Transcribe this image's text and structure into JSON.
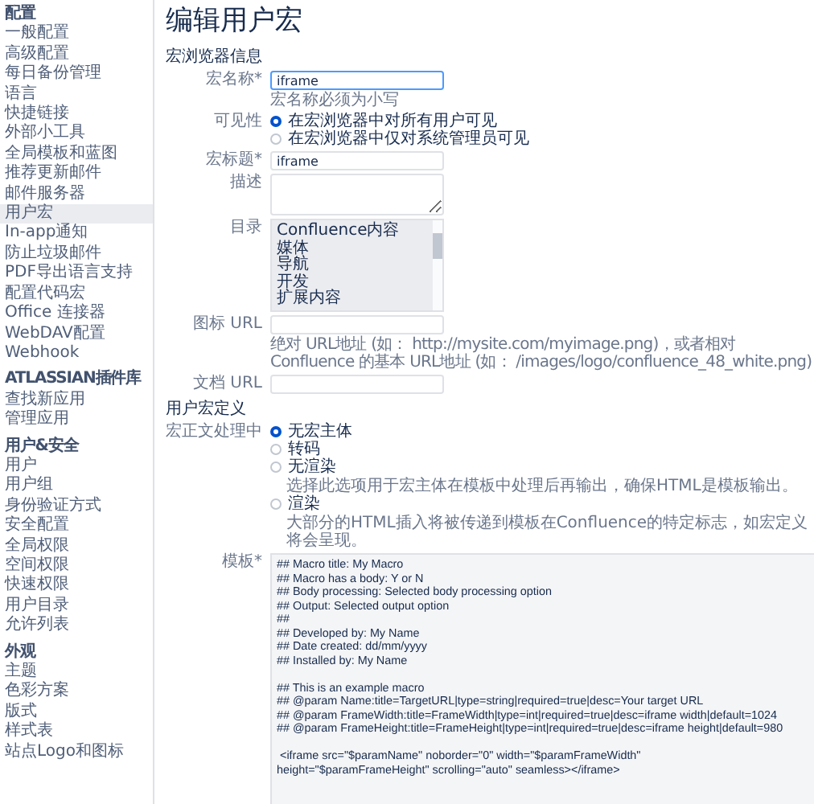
{
  "sidebar": {
    "sections": [
      {
        "heading": "配置",
        "items": [
          {
            "label": "一般配置",
            "selected": false
          },
          {
            "label": "高级配置",
            "selected": false
          },
          {
            "label": "每日备份管理",
            "selected": false
          },
          {
            "label": "语言",
            "selected": false
          },
          {
            "label": "快捷链接",
            "selected": false
          },
          {
            "label": "外部小工具",
            "selected": false
          },
          {
            "label": "全局模板和蓝图",
            "selected": false
          },
          {
            "label": "推荐更新邮件",
            "selected": false
          },
          {
            "label": "邮件服务器",
            "selected": false
          },
          {
            "label": "用户宏",
            "selected": true
          },
          {
            "label": "In-app通知",
            "selected": false
          },
          {
            "label": "防止垃圾邮件",
            "selected": false
          },
          {
            "label": "PDF导出语言支持",
            "selected": false
          },
          {
            "label": "配置代码宏",
            "selected": false
          },
          {
            "label": "Office 连接器",
            "selected": false
          },
          {
            "label": "WebDAV配置",
            "selected": false
          },
          {
            "label": "Webhook",
            "selected": false
          }
        ]
      },
      {
        "heading": "ATLASSIAN插件库",
        "items": [
          {
            "label": "查找新应用",
            "selected": false
          },
          {
            "label": "管理应用",
            "selected": false
          }
        ]
      },
      {
        "heading": "用户&安全",
        "items": [
          {
            "label": "用户",
            "selected": false
          },
          {
            "label": "用户组",
            "selected": false
          },
          {
            "label": "身份验证方式",
            "selected": false
          },
          {
            "label": "安全配置",
            "selected": false
          },
          {
            "label": "全局权限",
            "selected": false
          },
          {
            "label": "空间权限",
            "selected": false
          },
          {
            "label": "快速权限",
            "selected": false
          },
          {
            "label": "用户目录",
            "selected": false
          },
          {
            "label": "允许列表",
            "selected": false
          }
        ]
      },
      {
        "heading": "外观",
        "items": [
          {
            "label": "主题",
            "selected": false
          },
          {
            "label": "色彩方案",
            "selected": false
          },
          {
            "label": "版式",
            "selected": false
          },
          {
            "label": "样式表",
            "selected": false
          },
          {
            "label": "站点Logo和图标",
            "selected": false
          }
        ]
      }
    ]
  },
  "title": "编辑用户宏",
  "browser_section": {
    "heading": "宏浏览器信息",
    "name": {
      "label": "宏名称*",
      "value": "iframe",
      "help": "宏名称必须为小写"
    },
    "visibility": {
      "label": "可见性",
      "options": [
        {
          "label": "在宏浏览器中对所有用户可见",
          "selected": true
        },
        {
          "label": "在宏浏览器中仅对系统管理员可见",
          "selected": false
        }
      ]
    },
    "macro_title": {
      "label": "宏标题*",
      "value": "iframe"
    },
    "description": {
      "label": "描述"
    },
    "categories": {
      "label": "目录",
      "items": [
        "Confluence内容",
        "媒体",
        "导航",
        "开发",
        "扩展内容"
      ]
    },
    "icon_url": {
      "label": "图标 URL",
      "help": "绝对 URL地址 (如： http://mysite.com/myimage.png)，或者相对 Confluence 的基本 URL地址 (如： /images/logo/confluence_48_white.png)"
    },
    "doc_url": {
      "label": "文档 URL"
    }
  },
  "definition_section": {
    "heading": "用户宏定义",
    "body_processing": {
      "label": "宏正文处理中",
      "options": [
        {
          "label": "无宏主体",
          "selected": true
        },
        {
          "label": "转码",
          "selected": false
        },
        {
          "label": "无渲染",
          "selected": false,
          "help": "选择此选项用于宏主体在模板中处理后再输出，确保HTML是模板输出。"
        },
        {
          "label": "渲染",
          "selected": false,
          "help": "大部分的HTML插入将被传递到模板在Confluence的特定标志，如宏定义将会呈现。"
        }
      ]
    },
    "template": {
      "label": "模板*",
      "value": "## Macro title: My Macro\n## Macro has a body: Y or N\n## Body processing: Selected body processing option\n## Output: Selected output option\n##\n## Developed by: My Name\n## Date created: dd/mm/yyyy\n## Installed by: My Name\n\n## This is an example macro\n## @param Name:title=TargetURL|type=string|required=true|desc=Your target URL\n## @param FrameWidth:title=FrameWidth|type=int|required=true|desc=iframe width|default=1024\n## @param FrameHeight:title=FrameHeight|type=int|required=true|desc=iframe height|default=980\n\n <iframe src=\"$paramName\" noborder=\"0\" width=\"$paramFrameWidth\"\nheight=\"$paramFrameHeight\" scrolling=\"auto\" seamless></iframe>"
    }
  }
}
